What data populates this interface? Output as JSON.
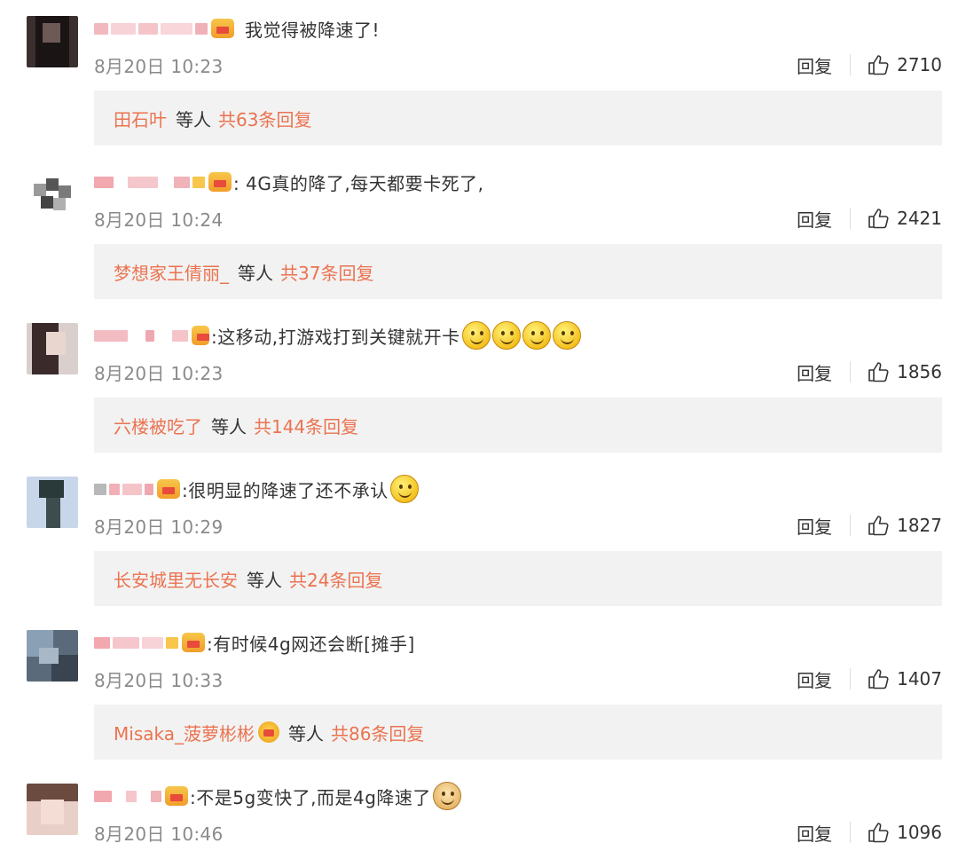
{
  "comments": [
    {
      "text": "我觉得被降速了!",
      "emojis": [],
      "date": "8月20日 10:23",
      "reply_label": "回复",
      "likes": "2710",
      "replier": "田石叶",
      "etc_label": "等人",
      "total": "共63条回复"
    },
    {
      "text": ": 4G真的降了,每天都要卡死了,",
      "emojis": [],
      "date": "8月20日 10:24",
      "reply_label": "回复",
      "likes": "2421",
      "replier": "梦想家王倩丽_",
      "etc_label": "等人",
      "total": "共37条回复"
    },
    {
      "text": ":这移动,打游戏打到关键就开卡",
      "emojis": [
        "smile-emoji",
        "smile-emoji",
        "smile-emoji",
        "smile-emoji"
      ],
      "date": "8月20日 10:23",
      "reply_label": "回复",
      "likes": "1856",
      "replier": "六楼被吃了",
      "etc_label": "等人",
      "total": "共144条回复"
    },
    {
      "text": ":很明显的降速了还不承认",
      "emojis": [
        "skeptical-emoji"
      ],
      "date": "8月20日 10:29",
      "reply_label": "回复",
      "likes": "1827",
      "replier": "长安城里无长安",
      "etc_label": "等人",
      "total": "共24条回复"
    },
    {
      "text": ":有时候4g网还会断[摊手]",
      "emojis": [],
      "date": "8月20日 10:33",
      "reply_label": "回复",
      "likes": "1407",
      "replier": "Misaka_菠萝彬彬",
      "etc_label": "等人",
      "total": "共86条回复"
    },
    {
      "text": ":不是5g变快了,而是4g降速了",
      "emojis": [
        "doge-emoji"
      ],
      "date": "8月20日 10:46",
      "reply_label": "回复",
      "likes": "1096",
      "replier": "",
      "etc_label": "",
      "total": ""
    }
  ],
  "colors": {
    "link": "#eb7350",
    "date": "#8a8a8a",
    "reply_box_bg": "#f2f2f2",
    "text": "#333333"
  }
}
